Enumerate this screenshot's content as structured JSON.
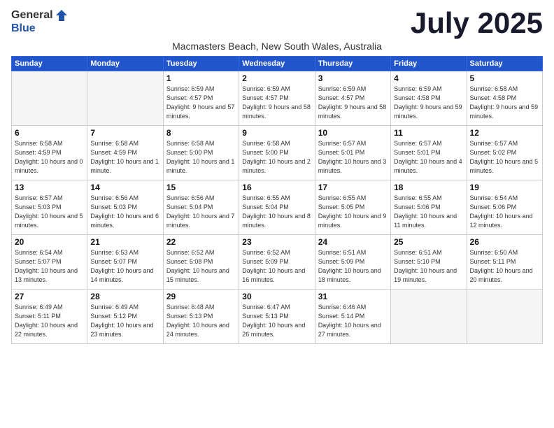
{
  "logo": {
    "general": "General",
    "blue": "Blue"
  },
  "title": "July 2025",
  "subtitle": "Macmasters Beach, New South Wales, Australia",
  "days_header": [
    "Sunday",
    "Monday",
    "Tuesday",
    "Wednesday",
    "Thursday",
    "Friday",
    "Saturday"
  ],
  "weeks": [
    [
      {
        "day": "",
        "info": ""
      },
      {
        "day": "",
        "info": ""
      },
      {
        "day": "1",
        "info": "Sunrise: 6:59 AM\nSunset: 4:57 PM\nDaylight: 9 hours\nand 57 minutes."
      },
      {
        "day": "2",
        "info": "Sunrise: 6:59 AM\nSunset: 4:57 PM\nDaylight: 9 hours\nand 58 minutes."
      },
      {
        "day": "3",
        "info": "Sunrise: 6:59 AM\nSunset: 4:57 PM\nDaylight: 9 hours\nand 58 minutes."
      },
      {
        "day": "4",
        "info": "Sunrise: 6:59 AM\nSunset: 4:58 PM\nDaylight: 9 hours\nand 59 minutes."
      },
      {
        "day": "5",
        "info": "Sunrise: 6:58 AM\nSunset: 4:58 PM\nDaylight: 9 hours\nand 59 minutes."
      }
    ],
    [
      {
        "day": "6",
        "info": "Sunrise: 6:58 AM\nSunset: 4:59 PM\nDaylight: 10 hours\nand 0 minutes."
      },
      {
        "day": "7",
        "info": "Sunrise: 6:58 AM\nSunset: 4:59 PM\nDaylight: 10 hours\nand 1 minute."
      },
      {
        "day": "8",
        "info": "Sunrise: 6:58 AM\nSunset: 5:00 PM\nDaylight: 10 hours\nand 1 minute."
      },
      {
        "day": "9",
        "info": "Sunrise: 6:58 AM\nSunset: 5:00 PM\nDaylight: 10 hours\nand 2 minutes."
      },
      {
        "day": "10",
        "info": "Sunrise: 6:57 AM\nSunset: 5:01 PM\nDaylight: 10 hours\nand 3 minutes."
      },
      {
        "day": "11",
        "info": "Sunrise: 6:57 AM\nSunset: 5:01 PM\nDaylight: 10 hours\nand 4 minutes."
      },
      {
        "day": "12",
        "info": "Sunrise: 6:57 AM\nSunset: 5:02 PM\nDaylight: 10 hours\nand 5 minutes."
      }
    ],
    [
      {
        "day": "13",
        "info": "Sunrise: 6:57 AM\nSunset: 5:03 PM\nDaylight: 10 hours\nand 5 minutes."
      },
      {
        "day": "14",
        "info": "Sunrise: 6:56 AM\nSunset: 5:03 PM\nDaylight: 10 hours\nand 6 minutes."
      },
      {
        "day": "15",
        "info": "Sunrise: 6:56 AM\nSunset: 5:04 PM\nDaylight: 10 hours\nand 7 minutes."
      },
      {
        "day": "16",
        "info": "Sunrise: 6:55 AM\nSunset: 5:04 PM\nDaylight: 10 hours\nand 8 minutes."
      },
      {
        "day": "17",
        "info": "Sunrise: 6:55 AM\nSunset: 5:05 PM\nDaylight: 10 hours\nand 9 minutes."
      },
      {
        "day": "18",
        "info": "Sunrise: 6:55 AM\nSunset: 5:06 PM\nDaylight: 10 hours\nand 11 minutes."
      },
      {
        "day": "19",
        "info": "Sunrise: 6:54 AM\nSunset: 5:06 PM\nDaylight: 10 hours\nand 12 minutes."
      }
    ],
    [
      {
        "day": "20",
        "info": "Sunrise: 6:54 AM\nSunset: 5:07 PM\nDaylight: 10 hours\nand 13 minutes."
      },
      {
        "day": "21",
        "info": "Sunrise: 6:53 AM\nSunset: 5:07 PM\nDaylight: 10 hours\nand 14 minutes."
      },
      {
        "day": "22",
        "info": "Sunrise: 6:52 AM\nSunset: 5:08 PM\nDaylight: 10 hours\nand 15 minutes."
      },
      {
        "day": "23",
        "info": "Sunrise: 6:52 AM\nSunset: 5:09 PM\nDaylight: 10 hours\nand 16 minutes."
      },
      {
        "day": "24",
        "info": "Sunrise: 6:51 AM\nSunset: 5:09 PM\nDaylight: 10 hours\nand 18 minutes."
      },
      {
        "day": "25",
        "info": "Sunrise: 6:51 AM\nSunset: 5:10 PM\nDaylight: 10 hours\nand 19 minutes."
      },
      {
        "day": "26",
        "info": "Sunrise: 6:50 AM\nSunset: 5:11 PM\nDaylight: 10 hours\nand 20 minutes."
      }
    ],
    [
      {
        "day": "27",
        "info": "Sunrise: 6:49 AM\nSunset: 5:11 PM\nDaylight: 10 hours\nand 22 minutes."
      },
      {
        "day": "28",
        "info": "Sunrise: 6:49 AM\nSunset: 5:12 PM\nDaylight: 10 hours\nand 23 minutes."
      },
      {
        "day": "29",
        "info": "Sunrise: 6:48 AM\nSunset: 5:13 PM\nDaylight: 10 hours\nand 24 minutes."
      },
      {
        "day": "30",
        "info": "Sunrise: 6:47 AM\nSunset: 5:13 PM\nDaylight: 10 hours\nand 26 minutes."
      },
      {
        "day": "31",
        "info": "Sunrise: 6:46 AM\nSunset: 5:14 PM\nDaylight: 10 hours\nand 27 minutes."
      },
      {
        "day": "",
        "info": ""
      },
      {
        "day": "",
        "info": ""
      }
    ]
  ]
}
